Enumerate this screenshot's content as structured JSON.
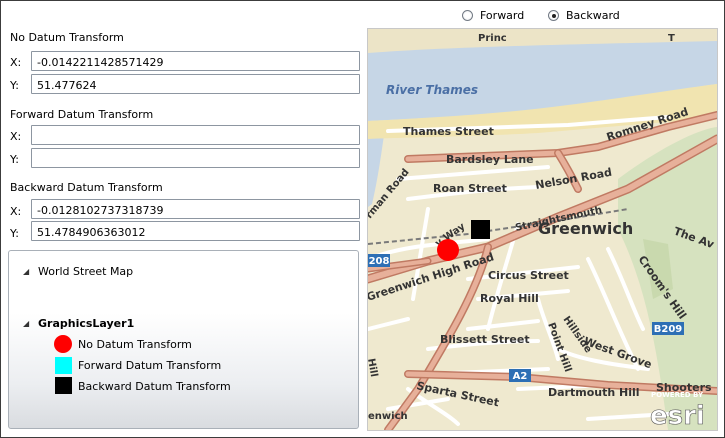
{
  "datum_mode": {
    "options": [
      {
        "label": "Forward",
        "selected": false
      },
      {
        "label": "Backward",
        "selected": true
      }
    ]
  },
  "no_datum": {
    "title": "No Datum Transform",
    "x_label": "X:",
    "y_label": "Y:",
    "x_value": "-0.0142211428571429",
    "y_value": "51.477624"
  },
  "forward_datum": {
    "title": "Forward Datum Transform",
    "x_label": "X:",
    "y_label": "Y:",
    "x_value": "",
    "y_value": ""
  },
  "backward_datum": {
    "title": "Backward Datum Transform",
    "x_label": "X:",
    "y_label": "Y:",
    "x_value": "-0.0128102737318739",
    "y_value": "51.4784906363012"
  },
  "legend": {
    "layers": [
      {
        "name": "World Street Map"
      },
      {
        "name": "GraphicsLayer1"
      }
    ],
    "items": [
      {
        "label": "No Datum Transform",
        "color": "#ff0000",
        "shape": "circle"
      },
      {
        "label": "Forward Datum Transform",
        "color": "#00ffff",
        "shape": "square"
      },
      {
        "label": "Backward Datum Transform",
        "color": "#000000",
        "shape": "square"
      }
    ]
  },
  "map": {
    "labels": {
      "river": "River Thames",
      "thames_street": "Thames Street",
      "bardsley_lane": "Bardsley Lane",
      "romney_road": "Romney Road",
      "nelson_road": "Nelson Road",
      "roan_street": "Roan Street",
      "greenwich": "Greenwich",
      "greenwich_high_road": "Greenwich High Road",
      "circus_street": "Circus Street",
      "royal_hill": "Royal Hill",
      "straightsmouth": "Straightsmouth",
      "point_hill": "Point Hill",
      "hillside": "Hillside",
      "blissett_street": "Blissett Street",
      "west_grove": "West Grove",
      "croom_hill": "Croom's Hill",
      "sparta_street": "Sparta Street",
      "dartmouth_hill": "Dartmouth Hill",
      "shooters": "Shooters",
      "the_avenue": "The Av",
      "a2_shield": "A2",
      "b209_shield": "B209",
      "a208_shield": "208",
      "roan_way_partial": "y Way",
      "norman_road_partial": "rman Road",
      "prince_partial": "Princ",
      "top_street_partial": "T",
      "hill_partial": "Hill",
      "greenwich_partial": "enwich"
    },
    "markers": [
      {
        "name": "No Datum Transform",
        "color": "#ff0000"
      },
      {
        "name": "Backward Datum Transform",
        "color": "#000000"
      }
    ],
    "attribution": {
      "powered_by": "POWERED BY",
      "brand": "esri"
    }
  },
  "colors": {
    "water": "#c6d6e6",
    "land": "#efe9cf",
    "park": "#d6e2bf",
    "major_road": "#e7b09a",
    "road_casing": "#c07a63"
  }
}
